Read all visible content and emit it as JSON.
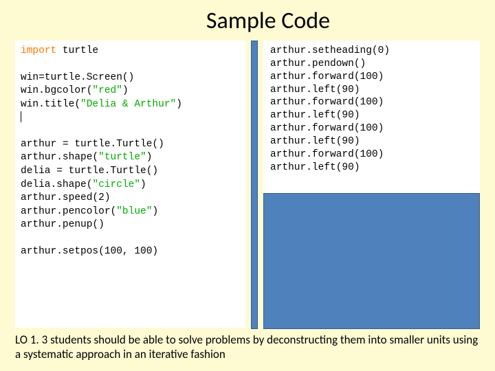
{
  "title": "Sample Code",
  "code_left": {
    "l1a": "import",
    "l1b": " turtle",
    "l2": "win=turtle.Screen()",
    "l3a": "win.bgcolor(",
    "l3b": "\"red\"",
    "l3c": ")",
    "l4a": "win.title(",
    "l4b": "\"Delia & Arthur\"",
    "l4c": ")",
    "l5": "arthur = turtle.Turtle()",
    "l6a": "arthur.shape(",
    "l6b": "\"turtle\"",
    "l6c": ")",
    "l7": "delia = turtle.Turtle()",
    "l8a": "delia.shape(",
    "l8b": "\"circle\"",
    "l8c": ")",
    "l9": "arthur.speed(2)",
    "l10a": "arthur.pencolor(",
    "l10b": "\"blue\"",
    "l10c": ")",
    "l11": "arthur.penup()",
    "l12": "arthur.setpos(100, 100)"
  },
  "code_right": {
    "r1": "arthur.setheading(0)",
    "r2": "arthur.pendown()",
    "r3": "arthur.forward(100)",
    "r4": "arthur.left(90)",
    "r5": "arthur.forward(100)",
    "r6": "arthur.left(90)",
    "r7": "arthur.forward(100)",
    "r8": "arthur.left(90)",
    "r9": "arthur.forward(100)",
    "r10": "arthur.left(90)"
  },
  "footer": "LO 1. 3 students should be able to solve problems by deconstructing them into smaller units using a systematic approach in an iterative fashion"
}
